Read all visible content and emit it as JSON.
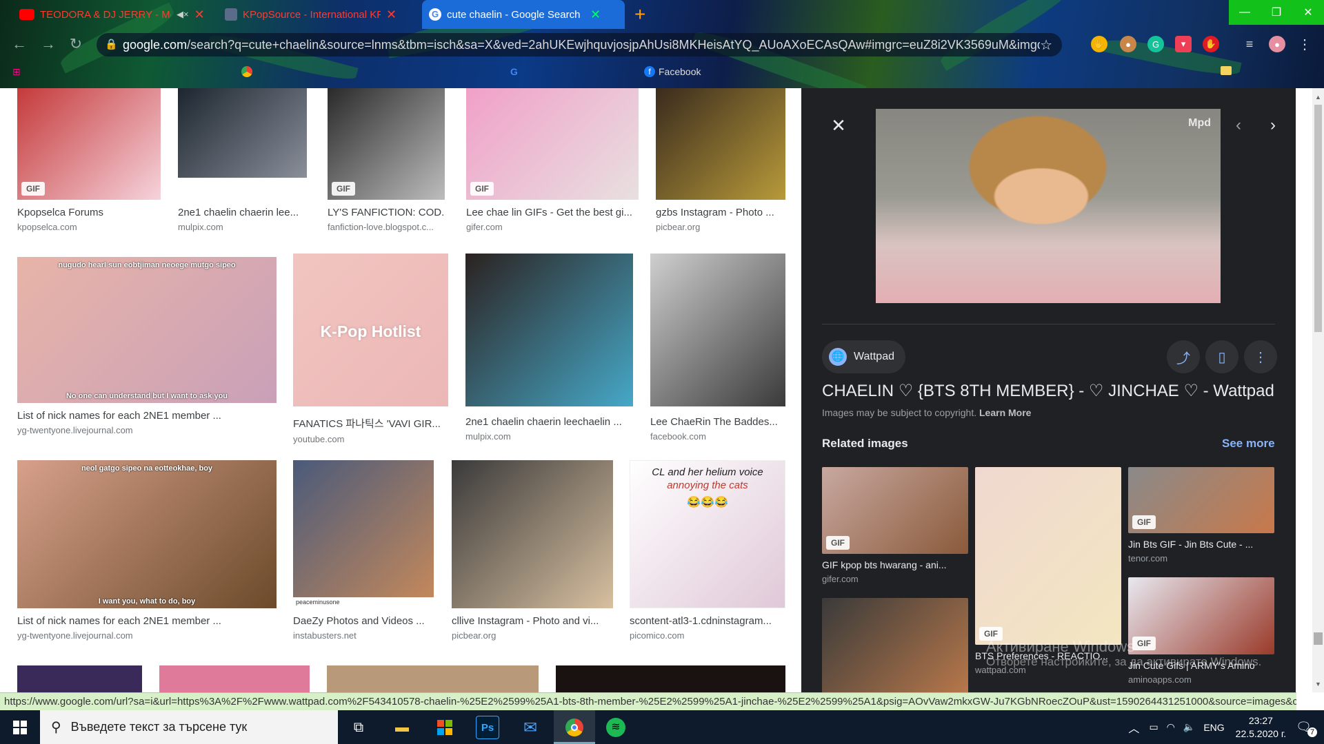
{
  "tabs": [
    {
      "title": "TEODORA & DJ JERRY - Mo",
      "favicon_color": "#ff0000",
      "muted": true
    },
    {
      "title": "KPopSource - International KPOP",
      "favicon_color": "#5b6b8a"
    },
    {
      "title": "cute chaelin - Google Search",
      "favicon_color": "#ffffff"
    }
  ],
  "address_bar": {
    "domain": "google.com",
    "url_rest": "/search?q=cute+chaelin&source=lnms&tbm=isch&sa=X&ved=2ahUKEwjhquvjosjpAhUsi8MKHeisAtYQ_AUoAXoECAsQAw#imgrc=euZ8i2VK3569uM&imgdii=G..."
  },
  "bookmarks": {
    "facebook": "Facebook"
  },
  "results": [
    {
      "title": "Kpopselca Forums",
      "source": "kpopselca.com",
      "gif": "GIF",
      "bg": "#c43a3a",
      "bg2": "#f6d3dc"
    },
    {
      "title": "2ne1 chaelin chaerin lee...",
      "source": "mulpix.com",
      "gif": "",
      "bg": "#1d2630",
      "bg2": "#8a8f9a"
    },
    {
      "title": "LY'S FANFICTION: COD...",
      "source": "fanfiction-love.blogspot.c...",
      "gif": "GIF",
      "bg": "#2a2a2a",
      "bg2": "#bdbdbd"
    },
    {
      "title": "Lee chae lin GIFs - Get the best gi...",
      "source": "gifer.com",
      "gif": "GIF",
      "bg": "#f0a0c8",
      "bg2": "#e8e0e0"
    },
    {
      "title": "gzbs Instagram - Photo ...",
      "source": "picbear.org",
      "gif": "",
      "bg": "#3a2b1d",
      "bg2": "#b89a3a"
    },
    {
      "title": "List of nick names for each 2NE1 member ...",
      "source": "yg-twentyone.livejournal.com",
      "gif": "",
      "bg": "#e8b4a8",
      "bg2": "#c9a0b8",
      "top_caption": "nugudo hearl sun eobtjiman neoege mutgo sipeo",
      "bottom_caption": "No one can understand but I want to ask you"
    },
    {
      "title": "FANATICS 파나틱스 'VAVI GIR...",
      "source": "youtube.com",
      "gif": "",
      "bg": "#f2c5c0",
      "bg2": "#ebb7b7",
      "overlay": "K-Pop Hotlist"
    },
    {
      "title": "2ne1 chaelin chaerin leechaelin ...",
      "source": "mulpix.com",
      "gif": "",
      "bg": "#2b2220",
      "bg2": "#46a8c8"
    },
    {
      "title": "Lee ChaeRin The Baddes...",
      "source": "facebook.com",
      "gif": "",
      "bg": "#cfcfcf",
      "bg2": "#3a3a3a"
    },
    {
      "title": "List of nick names for each 2NE1 member ...",
      "source": "yg-twentyone.livejournal.com",
      "gif": "",
      "bg": "#d7a08a",
      "bg2": "#6b4a2a",
      "top_caption": "neol gatgo sipeo na eotteokhae, boy",
      "bottom_caption": "I want you, what to do, boy"
    },
    {
      "title": "DaeZy Photos and Videos ...",
      "source": "instabusters.net",
      "gif": "",
      "bg": "#4a5a7a",
      "bg2": "#c88a5a",
      "footer": "peaceminusone"
    },
    {
      "title": "cllive Instagram - Photo and vi...",
      "source": "picbear.org",
      "gif": "",
      "bg": "#3a3a3a",
      "bg2": "#d8c0a0"
    },
    {
      "title": "scontent-atl3-1.cdninstagram...",
      "source": "picomico.com",
      "gif": "",
      "bg": "#ffffff",
      "bg2": "#e0c8d8",
      "text_line1": "CL and her helium voice",
      "text_line2": "annoying the cats",
      "emoji": "😂😂😂"
    }
  ],
  "panel": {
    "source_name": "Wattpad",
    "title": "CHAELIN ♡ {BTS 8TH MEMBER} - ♡ JINCHAE ♡ - Wattpad",
    "copyright": "Images may be subject to copyright.",
    "learn_more": "Learn More",
    "related_heading": "Related images",
    "see_more": "See more",
    "hero_watermark": "Mpd",
    "related": [
      {
        "title": "GIF kpop bts hwarang - ani...",
        "source": "gifer.com",
        "gif": "GIF",
        "bg": "#c8a8a0",
        "bg2": "#8a5a3a"
      },
      {
        "title": "BTS Preferences - REACTIO...",
        "source": "wattpad.com",
        "gif": "GIF",
        "bg": "#f0d8d0",
        "bg2": "#f3e6c0"
      },
      {
        "title": "Jin Bts GIF - Jin Bts Cute - ...",
        "source": "tenor.com",
        "gif": "GIF",
        "bg": "#8a8a8a",
        "bg2": "#c8784a"
      },
      {
        "title": "Jin Cute Gifs | ARMY's Amino",
        "source": "aminoapps.com",
        "gif": "GIF",
        "bg": "#e8e8f0",
        "bg2": "#9a3a2a"
      },
      {
        "title": "",
        "source": "",
        "gif": "",
        "bg": "#3a3a3a",
        "bg2": "#b8784a"
      }
    ]
  },
  "status_url": "https://www.google.com/url?sa=i&url=https%3A%2F%2Fwww.wattpad.com%2F543410578-chaelin-%25E2%2599%25A1-bts-8th-member-%25E2%2599%25A1-jinchae-%25E2%2599%25A1&psig=AOvVaw2mkxGW-Ju7KGbNRoecZOuP&ust=1590264431251000&source=images&cd...",
  "activation": {
    "line1": "Активиране Windows",
    "line2": "Отворете настройките, за да активирате Windows."
  },
  "taskbar": {
    "search_placeholder": "Въведете текст за търсене тук",
    "language": "ENG",
    "time": "23:27",
    "date": "22.5.2020 г.",
    "notifications": "7"
  }
}
